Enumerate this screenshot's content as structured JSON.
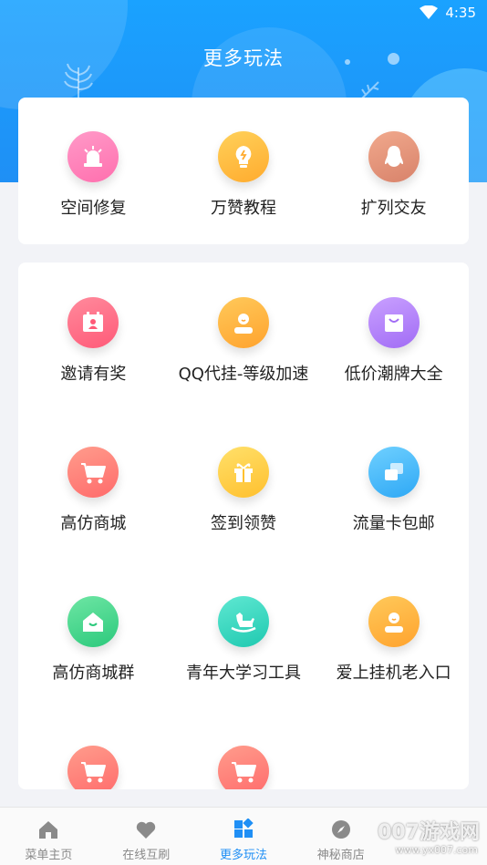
{
  "status_bar": {
    "time": "4:35"
  },
  "header": {
    "title": "更多玩法"
  },
  "top_card": {
    "items": [
      {
        "label": "空间修复",
        "icon": "alarm-light-icon",
        "color_from": "#ff9ac8",
        "color_to": "#ff6fae"
      },
      {
        "label": "万赞教程",
        "icon": "lightbulb-icon",
        "color_from": "#ffd15a",
        "color_to": "#ffab2e"
      },
      {
        "label": "扩列交友",
        "icon": "qq-penguin-icon",
        "color_from": "#f1a98d",
        "color_to": "#d8826a"
      }
    ]
  },
  "main_card": {
    "items": [
      {
        "label": "邀请有奖",
        "icon": "id-card-icon",
        "color_from": "#ff8a9c",
        "color_to": "#ff5a78"
      },
      {
        "label": "QQ代挂-等级加速",
        "icon": "user-avatar-icon",
        "color_from": "#ffc95a",
        "color_to": "#ffa32e"
      },
      {
        "label": "低价潮牌大全",
        "icon": "shopping-bag-icon",
        "color_from": "#c9a0ff",
        "color_to": "#a16cf5"
      },
      {
        "label": "高仿商城",
        "icon": "shopping-cart-icon",
        "color_from": "#ff9c8c",
        "color_to": "#ff6b6b"
      },
      {
        "label": "签到领赞",
        "icon": "gift-icon",
        "color_from": "#ffe06a",
        "color_to": "#ffc02e"
      },
      {
        "label": "流量卡包邮",
        "icon": "cards-icon",
        "color_from": "#6fd0ff",
        "color_to": "#2ea8f5"
      },
      {
        "label": "高仿商城群",
        "icon": "house-icon",
        "color_from": "#6ee6a4",
        "color_to": "#2cc97c"
      },
      {
        "label": "青年大学习工具",
        "icon": "rocking-horse-icon",
        "color_from": "#5fe8d2",
        "color_to": "#1fc9b0"
      },
      {
        "label": "爱上挂机老入口",
        "icon": "user-avatar-icon",
        "color_from": "#ffc95a",
        "color_to": "#ffa32e"
      },
      {
        "label": "",
        "icon": "shopping-cart-icon",
        "color_from": "#ff9c8c",
        "color_to": "#ff6b6b"
      },
      {
        "label": "",
        "icon": "shopping-cart-icon",
        "color_from": "#ff9c8c",
        "color_to": "#ff6b6b"
      }
    ]
  },
  "tab_bar": {
    "tabs": [
      {
        "label": "菜单主页",
        "icon": "home-icon"
      },
      {
        "label": "在线互刷",
        "icon": "heart-icon"
      },
      {
        "label": "更多玩法",
        "icon": "grid-apps-icon"
      },
      {
        "label": "神秘商店",
        "icon": "compass-icon"
      },
      {
        "label": "",
        "icon": ""
      }
    ],
    "active_index": 2,
    "active_color": "#1f8ff5"
  },
  "watermark": {
    "brand": "007游戏网",
    "url": "www.yx007.com"
  }
}
